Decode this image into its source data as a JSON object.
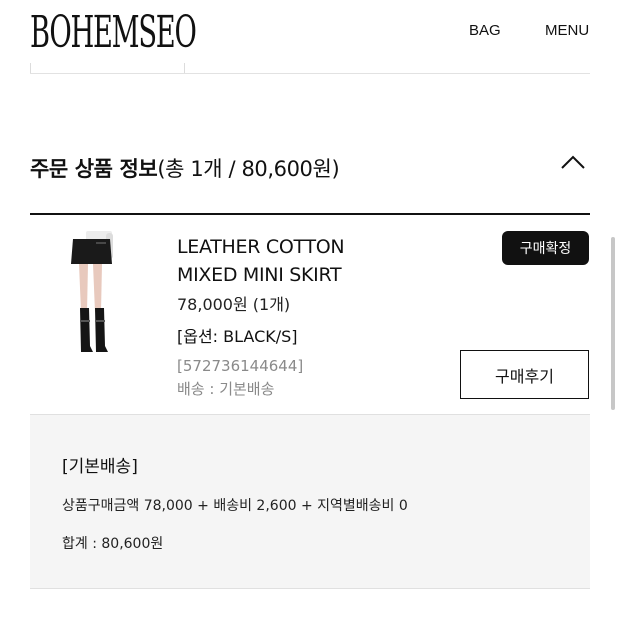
{
  "header": {
    "logo": "BOHEMSEO",
    "bag_label": "BAG",
    "menu_label": "MENU"
  },
  "section": {
    "title_prefix": "주문 상품 정보",
    "title_summary": "(총 1개 / 80,600원)",
    "collapse_icon": "chevron-up-icon"
  },
  "product": {
    "name_line1": "LEATHER COTTON",
    "name_line2": "MIXED MINI SKIRT",
    "price": "78,000원 (1개)",
    "option": "[옵션: BLACK/S]",
    "code": "[572736144644]",
    "shipping": "배송 : 기본배송",
    "status_badge": "구매확정",
    "review_button": "구매후기"
  },
  "summary": {
    "title": "[기본배송]",
    "breakdown": "상품구매금액 78,000 + 배송비 2,600 + 지역별배송비 0",
    "total": "합계 : 80,600원"
  },
  "colors": {
    "text": "#111111",
    "muted": "#8a8a8a",
    "summary_bg": "#f5f5f5",
    "badge_bg": "#111111"
  }
}
